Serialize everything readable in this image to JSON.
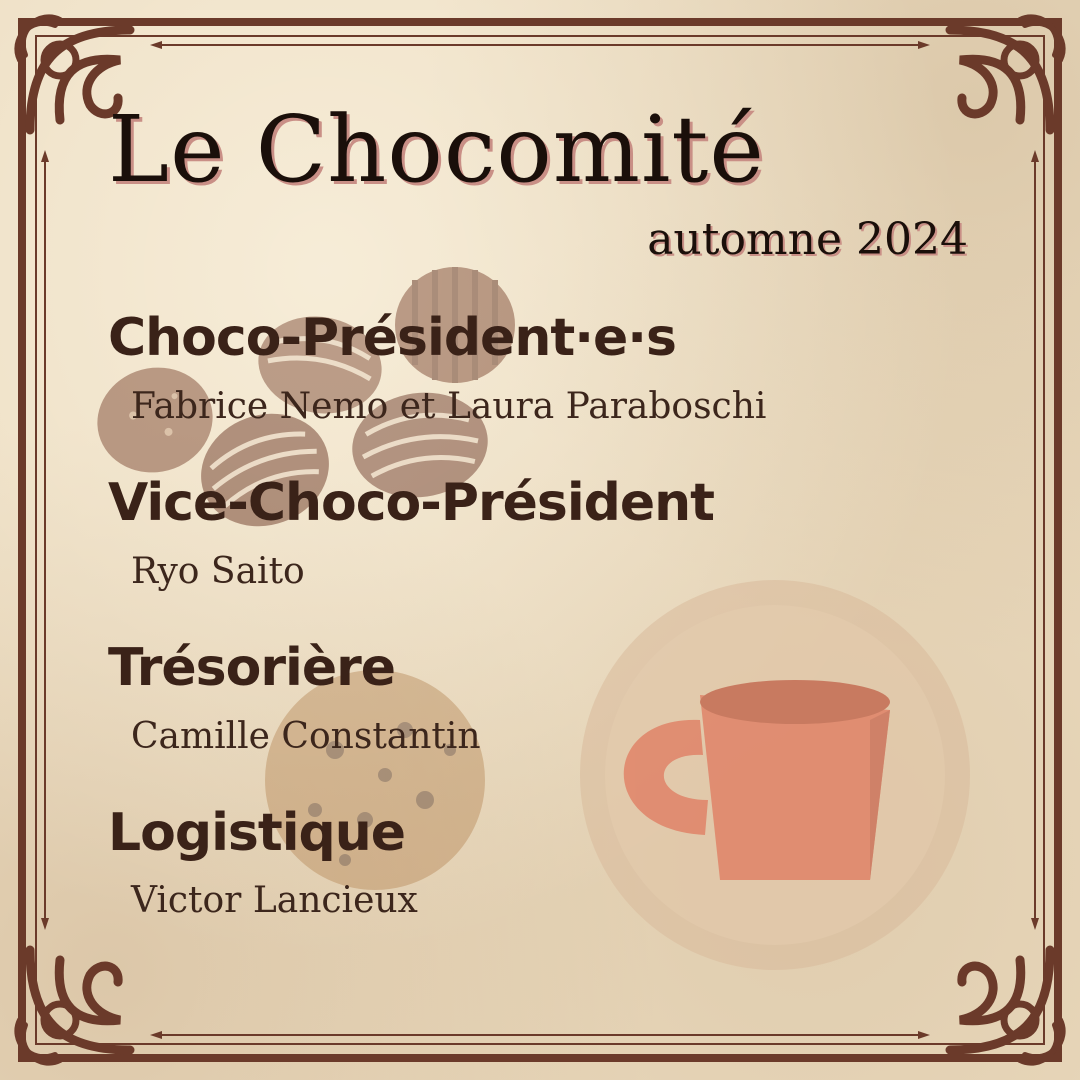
{
  "header": {
    "title": "Le Chocomité",
    "subtitle": "automne 2024"
  },
  "committee": [
    {
      "role": "Choco-Président·e·s",
      "member": "Fabrice Nemo et Laura Paraboschi"
    },
    {
      "role": "Vice-Choco-Président",
      "member": "Ryo Saito"
    },
    {
      "role": "Trésorière",
      "member": "Camille Constantin"
    },
    {
      "role": "Logistique",
      "member": "Victor Lancieux"
    }
  ],
  "colors": {
    "paper": "#ecdcc0",
    "frame": "#6b3a2a",
    "text": "#1a0f0a",
    "heading": "#3a2218",
    "title_shadow": "#c98f86",
    "mug": "#e07a5f"
  },
  "decorations": [
    "chocolate-truffles",
    "cookie",
    "hot-chocolate-mug-badge",
    "corner-flourishes"
  ]
}
